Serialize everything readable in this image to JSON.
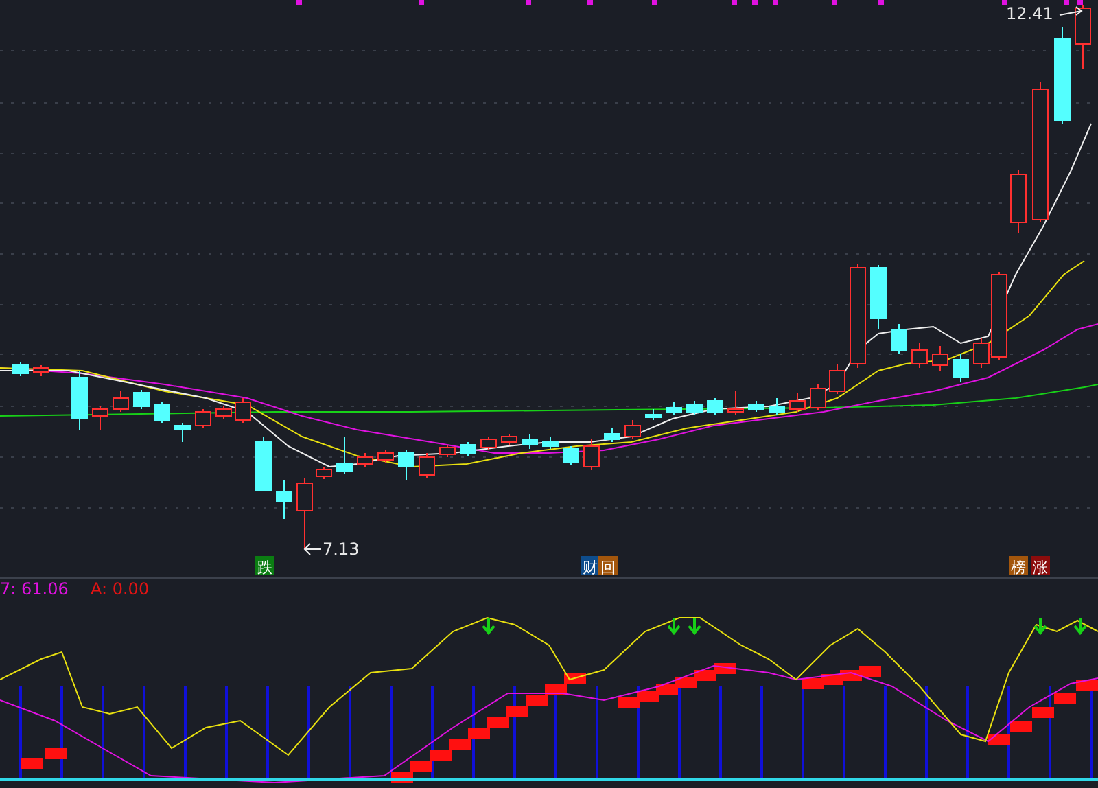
{
  "price_labels": [
    {
      "kind": "high",
      "text": "12.41"
    },
    {
      "kind": "low",
      "text": "7.13"
    }
  ],
  "signal_tags": [
    {
      "text": "跌",
      "color": "#0b7d12"
    },
    {
      "text": "财",
      "color": "#0e4d8c"
    },
    {
      "text": "回",
      "color": "#a3560c"
    },
    {
      "text": "榜",
      "color": "#a3560c"
    },
    {
      "text": "涨",
      "color": "#8c0c0c"
    }
  ],
  "indicator_legend": [
    {
      "text": "7: 61.06",
      "color": "#e012e0"
    },
    {
      "text": "A: 0.00",
      "color": "#e31414"
    }
  ]
}
